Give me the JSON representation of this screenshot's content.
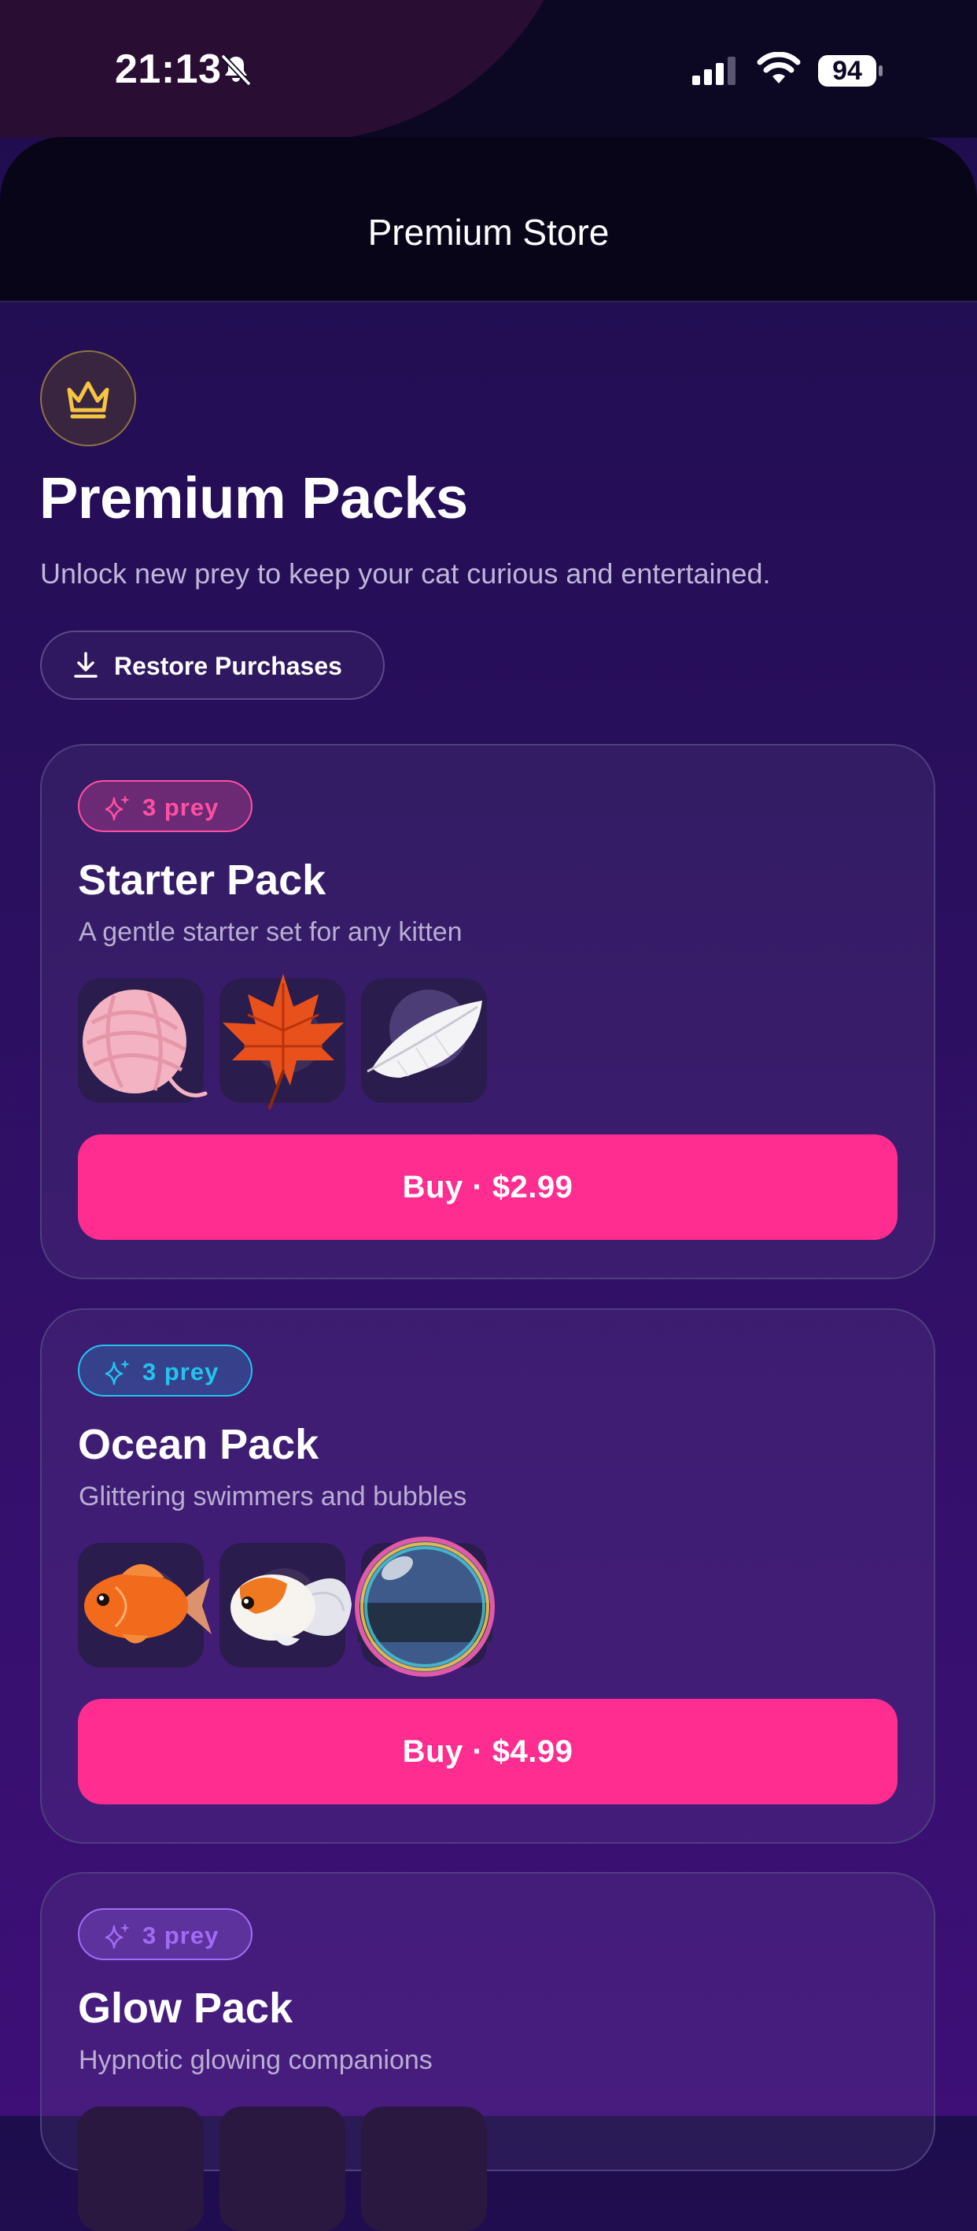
{
  "status_bar": {
    "time": "21:13",
    "battery": "94",
    "icons": [
      "bell-slash-icon",
      "cellular-signal-icon",
      "wifi-icon",
      "battery-icon"
    ]
  },
  "header": {
    "title": "Premium Store"
  },
  "hero": {
    "icon": "crown-icon",
    "title": "Premium Packs",
    "subtitle": "Unlock new prey to keep your cat curious and entertained.",
    "restore_label": "Restore Purchases"
  },
  "packs": [
    {
      "badge": "3 prey",
      "badge_color": "#ff4fa3",
      "name": "Starter Pack",
      "description": "A gentle starter set for any kitten",
      "prey_icons": [
        "yarn-ball-icon",
        "maple-leaf-icon",
        "feather-icon"
      ],
      "buy_label": "Buy · $2.99"
    },
    {
      "badge": "3 prey",
      "badge_color": "#22c4ee",
      "name": "Ocean Pack",
      "description": "Glittering swimmers and bubbles",
      "prey_icons": [
        "goldfish-icon",
        "fancy-goldfish-icon",
        "soap-bubble-icon"
      ],
      "buy_label": "Buy · $4.99"
    },
    {
      "badge": "3 prey",
      "badge_color": "#a06cf5",
      "name": "Glow Pack",
      "description": "Hypnotic glowing companions"
    }
  ],
  "colors": {
    "accent": "#ff2d8f",
    "background": "#2a0f5e",
    "header": "#080519"
  }
}
